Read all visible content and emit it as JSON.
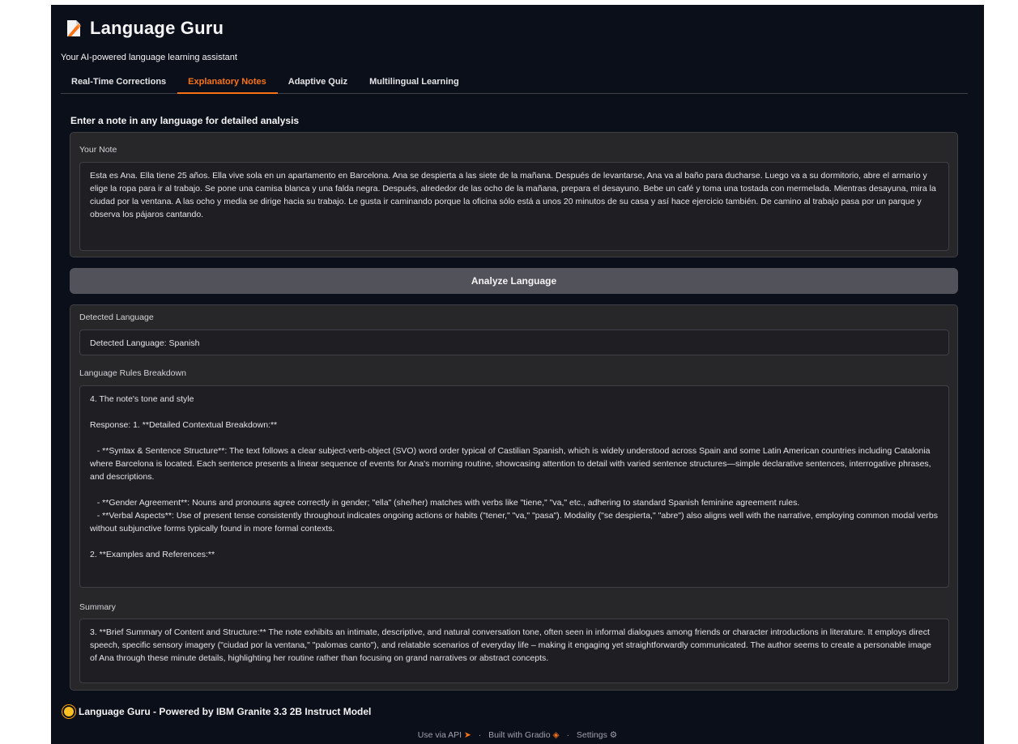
{
  "header": {
    "title": "Language Guru",
    "subtitle": "Your AI-powered language learning assistant"
  },
  "tabs": [
    {
      "label": "Real-Time Corrections",
      "active": false
    },
    {
      "label": "Explanatory Notes",
      "active": true
    },
    {
      "label": "Adaptive Quiz",
      "active": false
    },
    {
      "label": "Multilingual Learning",
      "active": false
    }
  ],
  "section": {
    "title": "Enter a note in any language for detailed analysis"
  },
  "note": {
    "label": "Your Note",
    "value": "Esta es Ana. Ella tiene 25 años. Ella vive sola en un apartamento en Barcelona. Ana se despierta a las siete de la mañana. Después de levantarse, Ana va al baño para ducharse. Luego va a su dormitorio, abre el armario y elige la ropa para ir al trabajo. Se pone una camisa blanca y una falda negra. Después, alrededor de las ocho de la mañana, prepara el desayuno. Bebe un café y toma una tostada con mermelada. Mientras desayuna, mira la ciudad por la ventana. A las ocho y media se dirige hacia su trabajo. Le gusta ir caminando porque la oficina sólo está a unos 20 minutos de su casa y así hace ejercicio también. De camino al trabajo pasa por un parque y observa los pájaros cantando."
  },
  "analyze_button": {
    "label": "Analyze Language"
  },
  "detected": {
    "label": "Detected Language",
    "value": "Detected Language: Spanish"
  },
  "rules": {
    "label": "Language Rules Breakdown",
    "paragraphs": [
      "4. The note's tone and style",
      "Response: 1. **Detailed Contextual Breakdown:**",
      "   - **Syntax & Sentence Structure**: The text follows a clear subject-verb-object (SVO) word order typical of Castilian Spanish, which is widely understood across Spain and some Latin American countries including Catalonia where Barcelona is located. Each sentence presents a linear sequence of events for Ana's morning routine, showcasing attention to detail with varied sentence structures—simple declarative sentences, interrogative phrases, and descriptions.",
      "   - **Gender Agreement**: Nouns and pronouns agree correctly in gender; \"ella\" (she/her) matches with verbs like \"tiene,\" \"va,\" etc., adhering to standard Spanish feminine agreement rules.\n   - **Verbal Aspects**: Use of present tense consistently throughout indicates ongoing actions or habits (\"tener,\" \"va,\" \"pasa\"). Modality (\"se despierta,\" \"abre\") also aligns well with the narrative, employing common modal verbs without subjunctive forms typically found in more formal contexts.",
      "2. **Examples and References:**"
    ]
  },
  "summary": {
    "label": "Summary",
    "value": "3. **Brief Summary of Content and Structure:**   The note exhibits an intimate, descriptive, and natural conversation tone, often seen in informal dialogues among friends or character introductions in literature. It employs direct speech, specific sensory imagery (\"ciudad por la ventana,\" \"palomas canto\"), and relatable scenarios of everyday life – making it engaging yet straightforwardly communicated. The author seems to create a personable image of Ana through these minute details, highlighting her routine rather than focusing on grand narratives or abstract concepts."
  },
  "footer": {
    "title": "Language Guru - Powered by IBM Granite 3.3 2B Instruct Model",
    "api_link": "Use via API",
    "gradio_link": "Built with Gradio",
    "settings_link": "Settings",
    "separator": "·"
  }
}
